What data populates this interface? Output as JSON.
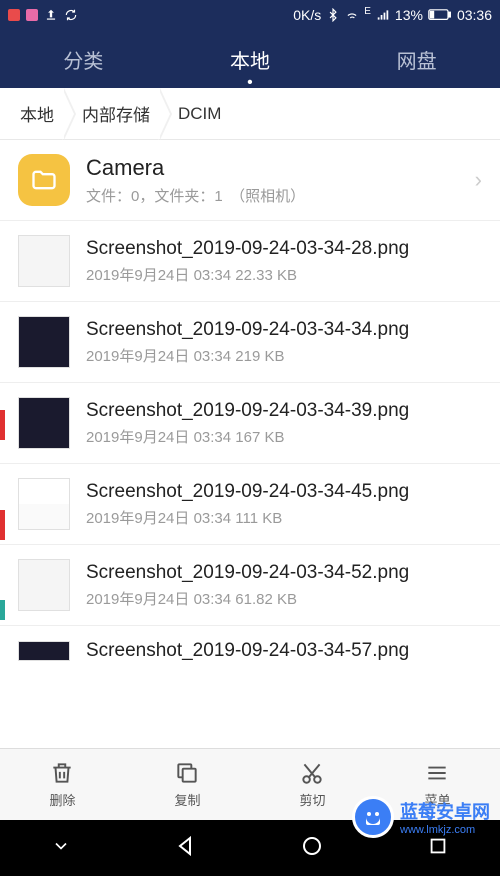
{
  "status": {
    "speed": "0K/s",
    "signal_label": "E",
    "battery_pct": "13%",
    "time": "03:36"
  },
  "tabs": {
    "category": "分类",
    "local": "本地",
    "cloud": "网盘"
  },
  "breadcrumb": {
    "root": "本地",
    "storage": "内部存储",
    "folder": "DCIM"
  },
  "folder": {
    "name": "Camera",
    "meta": "文件：0，文件夹：1　（照相机）"
  },
  "files": [
    {
      "name": "Screenshot_2019-09-24-03-34-28.png",
      "meta": "2019年9月24日 03:34 22.33 KB"
    },
    {
      "name": "Screenshot_2019-09-24-03-34-34.png",
      "meta": "2019年9月24日 03:34 219 KB"
    },
    {
      "name": "Screenshot_2019-09-24-03-34-39.png",
      "meta": "2019年9月24日 03:34 167 KB"
    },
    {
      "name": "Screenshot_2019-09-24-03-34-45.png",
      "meta": "2019年9月24日 03:34 111 KB"
    },
    {
      "name": "Screenshot_2019-09-24-03-34-52.png",
      "meta": "2019年9月24日 03:34 61.82 KB"
    },
    {
      "name": "Screenshot_2019-09-24-03-34-57.png",
      "meta": ""
    }
  ],
  "toolbar": {
    "delete": "删除",
    "copy": "复制",
    "cut": "剪切",
    "menu": "菜单"
  },
  "watermark": {
    "title": "蓝莓安卓网",
    "url": "www.lmkjz.com"
  }
}
